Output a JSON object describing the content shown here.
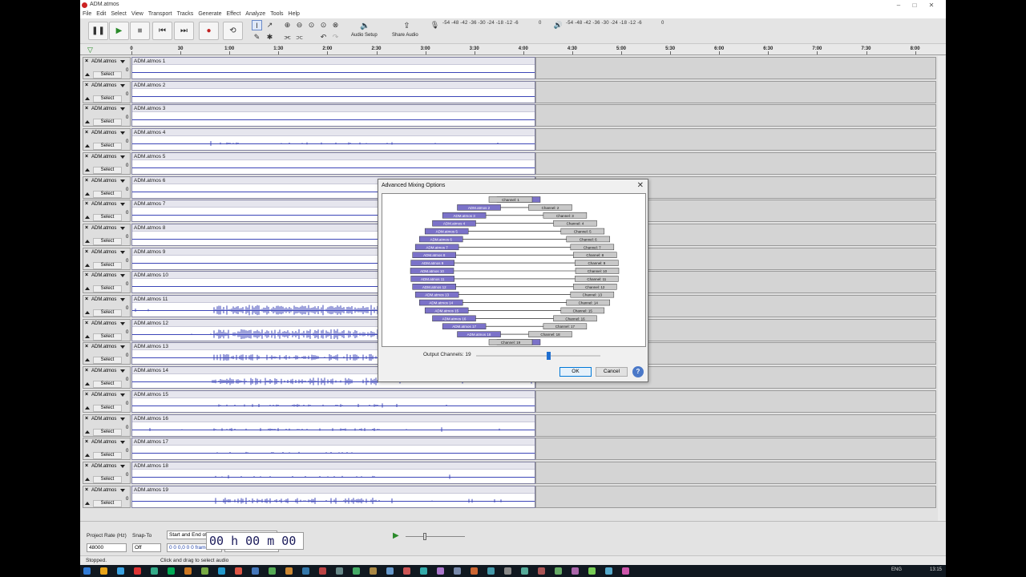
{
  "window": {
    "title": "ADM.atmos",
    "min": "–",
    "max": "□",
    "close": "✕"
  },
  "menu": [
    "File",
    "Edit",
    "Select",
    "View",
    "Transport",
    "Tracks",
    "Generate",
    "Effect",
    "Analyze",
    "Tools",
    "Help"
  ],
  "toolbar": {
    "audio_setup": "Audio Setup",
    "share_audio": "Share Audio",
    "rec_meter": "-54 -48 -42 -36 -30 -24 -18 -12 -6",
    "play_meter": "-54 -48 -42 -36 -30 -24 -18 -12 -6",
    "rec_meter_end": "0",
    "play_meter_end": "0"
  },
  "ruler": [
    "0",
    "30",
    "1:00",
    "1:30",
    "2:00",
    "2:30",
    "3:00",
    "3:30",
    "4:00",
    "4:30",
    "5:00",
    "5:30",
    "6:00",
    "6:30",
    "7:00",
    "7:30",
    "8:00"
  ],
  "tracks": [
    {
      "ctrl": "ADM.atmos",
      "clip": "ADM.atmos 1",
      "select": "Select",
      "scale": "0"
    },
    {
      "ctrl": "ADM.atmos",
      "clip": "ADM.atmos 2",
      "select": "Select",
      "scale": "0"
    },
    {
      "ctrl": "ADM.atmos",
      "clip": "ADM.atmos 3",
      "select": "Select",
      "scale": "0"
    },
    {
      "ctrl": "ADM.atmos",
      "clip": "ADM.atmos 4",
      "select": "Select",
      "scale": "0"
    },
    {
      "ctrl": "ADM.atmos",
      "clip": "ADM.atmos 5",
      "select": "Select",
      "scale": "0"
    },
    {
      "ctrl": "ADM.atmos",
      "clip": "ADM.atmos 6",
      "select": "Select",
      "scale": "0"
    },
    {
      "ctrl": "ADM.atmos",
      "clip": "ADM.atmos 7",
      "select": "Select",
      "scale": "0"
    },
    {
      "ctrl": "ADM.atmos",
      "clip": "ADM.atmos 8",
      "select": "Select",
      "scale": "0"
    },
    {
      "ctrl": "ADM.atmos",
      "clip": "ADM.atmos 9",
      "select": "Select",
      "scale": "0"
    },
    {
      "ctrl": "ADM.atmos",
      "clip": "ADM.atmos 10",
      "select": "Select",
      "scale": "0"
    },
    {
      "ctrl": "ADM.atmos",
      "clip": "ADM.atmos 11",
      "select": "Select",
      "scale": "0"
    },
    {
      "ctrl": "ADM.atmos",
      "clip": "ADM.atmos 12",
      "select": "Select",
      "scale": "0"
    },
    {
      "ctrl": "ADM.atmos",
      "clip": "ADM.atmos 13",
      "select": "Select",
      "scale": "0"
    },
    {
      "ctrl": "ADM.atmos",
      "clip": "ADM.atmos 14",
      "select": "Select",
      "scale": "0"
    },
    {
      "ctrl": "ADM.atmos",
      "clip": "ADM.atmos 15",
      "select": "Select",
      "scale": "0"
    },
    {
      "ctrl": "ADM.atmos",
      "clip": "ADM.atmos 16",
      "select": "Select",
      "scale": "0"
    },
    {
      "ctrl": "ADM.atmos",
      "clip": "ADM.atmos 17",
      "select": "Select",
      "scale": "0"
    },
    {
      "ctrl": "ADM.atmos",
      "clip": "ADM.atmos 18",
      "select": "Select",
      "scale": "0"
    },
    {
      "ctrl": "ADM.atmos",
      "clip": "ADM.atmos 19",
      "select": "Select",
      "scale": "0"
    }
  ],
  "dialog": {
    "title": "Advanced Mixing Options",
    "close": "✕",
    "inputs": [
      "ADM.atmos 1",
      "ADM.atmos 2",
      "ADM.atmos 3",
      "ADM.atmos 4",
      "ADM.atmos 5",
      "ADM.atmos 6",
      "ADM.atmos 7",
      "ADM.atmos 8",
      "ADM.atmos 9",
      "ADM.atmos 10",
      "ADM.atmos 11",
      "ADM.atmos 12",
      "ADM.atmos 13",
      "ADM.atmos 14",
      "ADM.atmos 15",
      "ADM.atmos 16",
      "ADM.atmos 17",
      "ADM.atmos 18",
      "ADM.atmos 19"
    ],
    "outputs": [
      "Channel: 1",
      "Channel: 2",
      "Channel: 3",
      "Channel: 4",
      "Channel: 5",
      "Channel: 6",
      "Channel: 7",
      "Channel: 8",
      "Channel: 9",
      "Channel: 10",
      "Channel: 11",
      "Channel: 12",
      "Channel: 13",
      "Channel: 14",
      "Channel: 15",
      "Channel: 16",
      "Channel: 17",
      "Channel: 18",
      "Channel: 19"
    ],
    "output_channels_label": "Output Channels: 19",
    "output_channels_value": 19,
    "ok": "OK",
    "cancel": "Cancel",
    "help": "?"
  },
  "selection": {
    "project_rate_label": "Project Rate (Hz)",
    "project_rate": "48000",
    "snap_label": "Snap-To",
    "snap": "Off",
    "mode": "Start and End of Selection",
    "start": "0 0 0,0 0 0 frames",
    "end": "0 0 7,4 2 3 frames",
    "time": "00 h 00 m 00 s"
  },
  "status": {
    "left": "Stopped.",
    "right": "Click and drag to select audio"
  },
  "taskbar": {
    "lang": "ENG",
    "time": "13:15"
  },
  "colors": {
    "input_box": "#7b72c9",
    "output_box": "#c8c8c8",
    "waveform": "#3c46b8"
  }
}
